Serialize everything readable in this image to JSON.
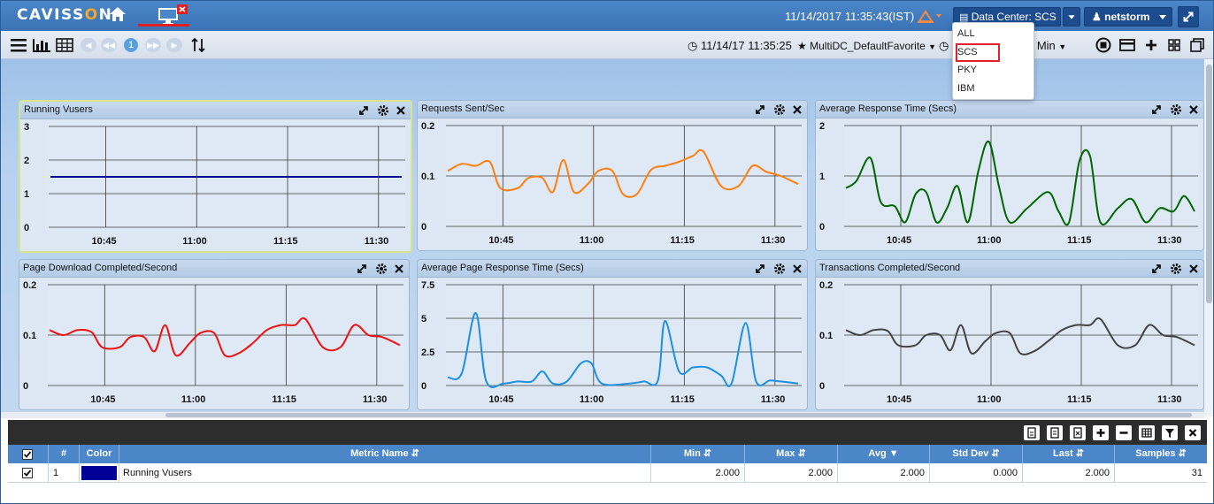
{
  "header": {
    "logo_pre": "CAVISS",
    "logo_o": "O",
    "logo_post": "N",
    "datetime": "11/14/2017 11:35:43(IST)",
    "data_center": "Data Center: SCS",
    "user": "netstorm"
  },
  "dropdown": {
    "items": [
      "ALL",
      "SCS",
      "PKY",
      "IBM"
    ],
    "selected": "SCS"
  },
  "toolbar": {
    "page": "1",
    "time": "11/14/17 11:35:25",
    "favorite": "MultiDC_DefaultFavorite",
    "interval": "2 Min"
  },
  "colors": {
    "vusers": "#000099",
    "requests": "#ff7f0e",
    "response": "#006600",
    "download": "#ee1111",
    "page_response": "#1e90e0",
    "transactions": "#444444"
  },
  "panels": [
    {
      "title": "Running Vusers",
      "yticks": [
        "3",
        "2",
        "1",
        "0"
      ],
      "xticks": [
        "10:45",
        "11:00",
        "11:15",
        "11:30"
      ]
    },
    {
      "title": "Requests Sent/Sec",
      "yticks": [
        "0.2",
        "0.1",
        "0"
      ],
      "xticks": [
        "10:45",
        "11:00",
        "11:15",
        "11:30"
      ]
    },
    {
      "title": "Average Response Time (Secs)",
      "yticks": [
        "2",
        "1",
        "0"
      ],
      "xticks": [
        "10:45",
        "11:00",
        "11:15",
        "11:30"
      ]
    },
    {
      "title": "Page Download Completed/Second",
      "yticks": [
        "0.2",
        "0.1",
        "0"
      ],
      "xticks": [
        "10:45",
        "11:00",
        "11:15",
        "11:30"
      ]
    },
    {
      "title": "Average Page Response Time (Secs)",
      "yticks": [
        "7.5",
        "5",
        "2.5",
        "0"
      ],
      "xticks": [
        "10:45",
        "11:00",
        "11:15",
        "11:30"
      ]
    },
    {
      "title": "Transactions Completed/Second",
      "yticks": [
        "0.2",
        "0.1",
        "0"
      ],
      "xticks": [
        "10:45",
        "11:00",
        "11:15",
        "11:30"
      ]
    }
  ],
  "table": {
    "headers": [
      "#",
      "Color",
      "Metric Name",
      "Min",
      "Max",
      "Avg",
      "Std Dev",
      "Last",
      "Samples"
    ],
    "row": {
      "index": "1",
      "metric": "Running Vusers",
      "min": "2.000",
      "max": "2.000",
      "avg": "2.000",
      "stddev": "0.000",
      "last": "2.000",
      "samples": "31"
    }
  }
}
